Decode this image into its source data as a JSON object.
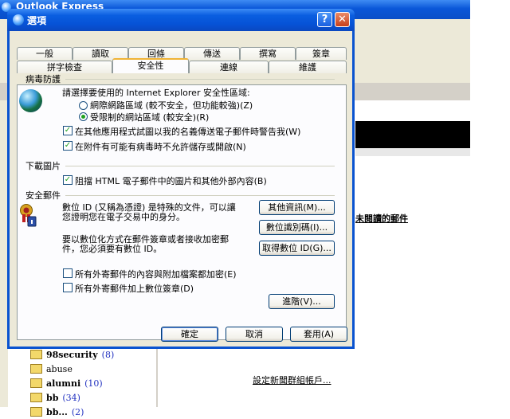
{
  "background": {
    "app_title": "Outlook Express",
    "read_link": "未閱讀的郵件",
    "news_link": "設定新聞群組帳戶...",
    "folders": [
      {
        "name": "98security",
        "count": "(8)"
      },
      {
        "name": "abuse",
        "count": ""
      },
      {
        "name": "alumni",
        "count": "(10)"
      },
      {
        "name": "bb",
        "count": "(34)"
      },
      {
        "name": "bb...",
        "count": "(2)"
      }
    ]
  },
  "dialog": {
    "title": "選項",
    "help_glyph": "?",
    "close_glyph": "✕",
    "tabs_row1": [
      "一般",
      "讀取",
      "回條",
      "傳送",
      "撰寫",
      "簽章"
    ],
    "tabs_row2": [
      "拼字檢查",
      "安全性",
      "連線",
      "維護"
    ],
    "active_tab": "安全性",
    "virus": {
      "group_title": "病毒防護",
      "zone_prompt": "請選擇要使用的 Internet Explorer 安全性區域:",
      "radio_internet": "網際網路區域 (較不安全，但功能較強)(Z)",
      "radio_restricted": "受限制的網站區域 (較安全)(R)",
      "check_warn": "在其他應用程式試圖以我的名義傳送電子郵件時警告我(W)",
      "check_block_attach": "在附件有可能有病毒時不允許儲存或開啟(N)"
    },
    "download": {
      "group_title": "下載圖片",
      "check_block_images": "阻擋 HTML 電子郵件中的圖片和其他外部內容(B)"
    },
    "secure": {
      "group_title": "安全郵件",
      "desc1_line1": "數位 ID (又稱為憑證) 是特殊的文件，可以讓",
      "desc1_line2": "您證明您在電子交易中的身分。",
      "desc2_line1": "要以數位化方式在郵件簽章或者接收加密郵",
      "desc2_line2": "件，您必須要有數位 ID。",
      "btn_more_info": "其他資訊(M)...",
      "btn_digital_ids": "數位識別碼(I)...",
      "btn_get_id": "取得數位 ID(G)...",
      "check_encrypt": "所有外寄郵件的內容與附加檔案都加密(E)",
      "check_sign": "所有外寄郵件加上數位簽章(D)",
      "btn_advanced": "進階(V)..."
    },
    "footer": {
      "ok": "確定",
      "cancel": "取消",
      "apply": "套用(A)"
    }
  }
}
